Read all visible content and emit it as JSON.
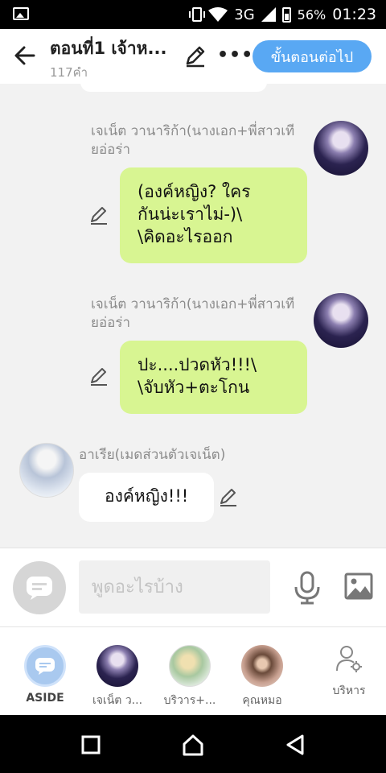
{
  "status_bar": {
    "network": "3G",
    "battery": "56%",
    "time": "01:23"
  },
  "header": {
    "title": "ตอนที่1 เจ้าห...",
    "word_count": "117คำ",
    "next_button": "ขั้นตอนต่อไป"
  },
  "messages": [
    {
      "sender": "เจเน็ต วานาริก้า(นางเอก+พี่สาวเทียอ่อร่า",
      "text": "(องค์หญิง? ใคร\nกันน่ะเราไม่-)\\\n\\คิดอะไรออก",
      "side": "right"
    },
    {
      "sender": "เจเน็ต วานาริก้า(นางเอก+พี่สาวเทียอ่อร่า",
      "text": "ปะ....ปวดหัว!!!\\\n\\จับหัว+ตะโกน",
      "side": "right"
    },
    {
      "sender": "อาเรีย(เมดส่วนตัวเจเน็ต)",
      "text": "องค์หญิง!!!",
      "side": "left"
    }
  ],
  "input": {
    "placeholder": "พูดอะไรบ้าง"
  },
  "characters": [
    {
      "label": "ASIDE"
    },
    {
      "label": "เจเน็ต ว..."
    },
    {
      "label": "บริวาร+..."
    },
    {
      "label": "คุณหมอ"
    },
    {
      "label": "บริหาร"
    }
  ],
  "colors": {
    "accent": "#59a8f3",
    "bubble_right": "#d8f592",
    "bubble_left": "#ffffff"
  }
}
